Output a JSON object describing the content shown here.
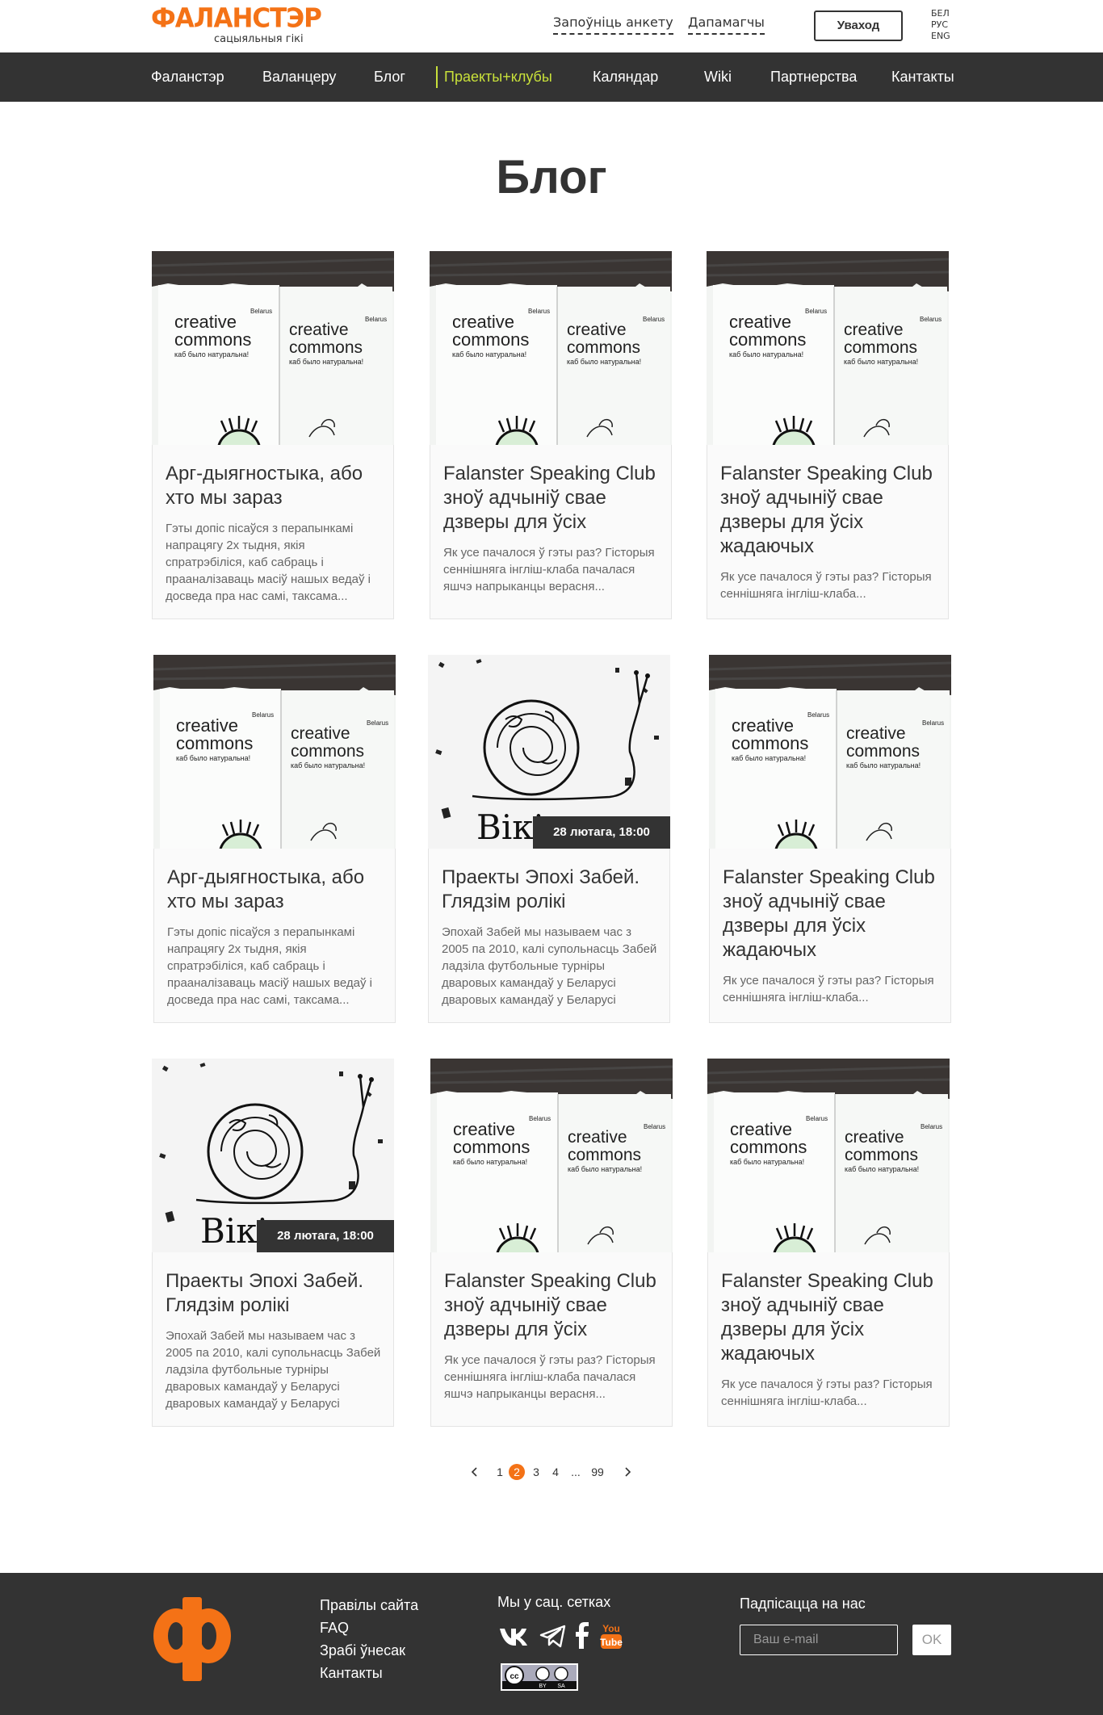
{
  "header": {
    "logo_text": "ФАЛАНСТЭР",
    "logo_sub": "сацыяльныя гікі",
    "questionnaire": "Запоўніць анкету",
    "helpers": "Дапамагчы",
    "login": "Уваход",
    "languages": [
      "БЕЛ",
      "РУС",
      "ENG"
    ]
  },
  "nav": {
    "items": [
      "Фаланстэр",
      "Валанцеру",
      "Блог",
      "Праекты+клубы",
      "Каляндар",
      "Wiki",
      "Партнерства",
      "Кантакты"
    ],
    "active": "Праекты+клубы"
  },
  "page_title": "Блог",
  "posts": [
    {
      "title": "Арг-дыягностыка, або хто мы зараз",
      "excerpt": "Гэты допіс пісаўся з перапынкамі напрацягу 2х тыдня, якія спратрэбіліся, каб сабраць  і прааналізаваць масіў  нашых ведаў і досведа пра нас самі, таксама...",
      "image": "creative-commons-poster",
      "date": ""
    },
    {
      "title": "Falanster Speaking Club зноў адчыніў свае дзверы для ўсіх",
      "excerpt": "Як усе пачалося ў гэты раз? Гісторыя сеннiшняга інгліш-клаба пачалася яшчэ напрыканцы верасня...",
      "image": "creative-commons-poster",
      "date": ""
    },
    {
      "title": "Falanster Speaking Club зноў адчыніў свае дзверы для ўсіх жадаючых",
      "excerpt": "Як усе пачалося ў гэты раз? Гісторыя сеннiшняга інгліш-клаба...",
      "image": "creative-commons-poster",
      "date": ""
    },
    {
      "title": "Арг-дыягностыка, або хто мы зараз",
      "excerpt": "Гэты допіс пісаўся з перапынкамі напрацягу 2х тыдня, якія спратрэбіліся, каб сабраць  і прааналізаваць масіў  нашых ведаў і досведа пра нас самі, таксама...",
      "image": "creative-commons-poster",
      "date": ""
    },
    {
      "title": "Праекты Эпохі Забей. Глядзім ролікі",
      "excerpt": "Эпохай Забей мы называем час з 2005 па 2010, калі супольнасць Забей ладзіла футбольные турніры дваровых камандаў у Беларусі дваровых камандаў у Беларусі",
      "image": "snail-drawing",
      "date": "28  лютага, 18:00"
    },
    {
      "title": "Falanster Speaking Club зноў адчыніў свае дзверы для ўсіх жадаючых",
      "excerpt": "Як усе пачалося ў гэты раз? Гісторыя сеннiшняга інгліш-клаба...",
      "image": "creative-commons-poster",
      "date": ""
    },
    {
      "title": "Праекты Эпохі Забей. Глядзім ролікі",
      "excerpt": "Эпохай Забей мы называем час з 2005 па 2010, калі супольнасць Забей ладзіла футбольные турніры дваровых камандаў у Беларусі дваровых камандаў у Беларусі",
      "image": "snail-drawing",
      "date": "28  лютага, 18:00"
    },
    {
      "title": "Falanster Speaking Club зноў адчыніў свае дзверы для ўсіх",
      "excerpt": "Як усе пачалося ў гэты раз? Гісторыя сеннiшняга інгліш-клаба пачалася яшчэ напрыканцы верасня...",
      "image": "creative-commons-poster",
      "date": ""
    },
    {
      "title": "Falanster Speaking Club зноў адчыніў свае дзверы для ўсіх жадаючых",
      "excerpt": "Як усе пачалося ў гэты раз? Гісторыя сеннiшняга інгліш-клаба...",
      "image": "creative-commons-poster",
      "date": ""
    }
  ],
  "poster_text": {
    "brand_line1": "creative",
    "brand_line2": "commons",
    "country": "Belarus",
    "slogan": "каб было натуральна!",
    "snail_caption": "Вікі"
  },
  "pagination": {
    "pages": [
      "1",
      "2",
      "3",
      "4",
      "...",
      "99"
    ],
    "current": "2",
    "prev_icon": "chevron-left-icon",
    "next_icon": "chevron-right-icon"
  },
  "footer": {
    "links": [
      "Правілы сайта",
      "FAQ",
      "Зрабі ўнесак",
      "Кантакты"
    ],
    "social_heading": "Мы у сац. сетках",
    "social_icons": [
      "vk-icon",
      "telegram-icon",
      "facebook-icon",
      "youtube-icon"
    ],
    "youtube_label": "You Tube",
    "license_label": "cc BY SA",
    "subscribe_heading": "Падпісацца на нас",
    "email_placeholder": "Ваш e-mail",
    "ok": "OK"
  },
  "colors": {
    "brand": "#f47216",
    "dark": "#333333",
    "active_nav": "#c8e03a"
  }
}
